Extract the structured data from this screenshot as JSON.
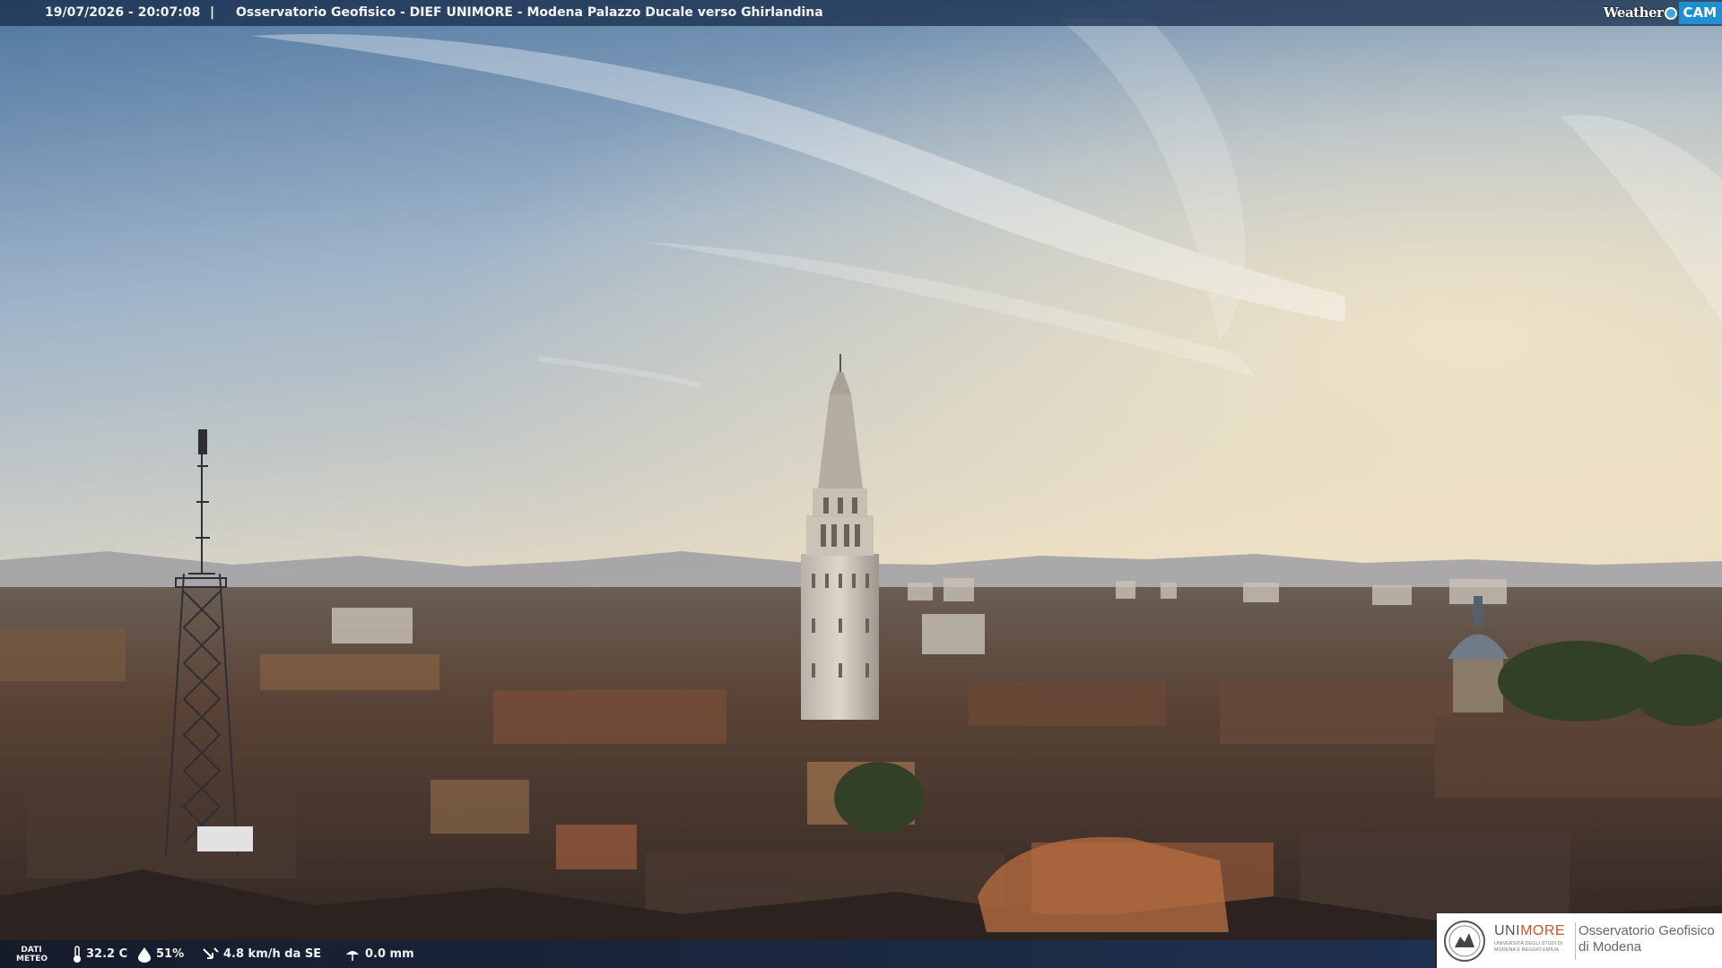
{
  "header": {
    "datetime": "19/07/2026 - 20:07:08",
    "separator": "|",
    "title": "Osservatorio Geofisico - DIEF UNIMORE - Modena Palazzo Ducale verso Ghirlandina",
    "brand_weather": "Weather",
    "brand_cam": "CAM"
  },
  "footer": {
    "dati_label": "DATI",
    "meteo_label": "METEO",
    "temperature": "32.2 C",
    "humidity": "51%",
    "wind": "4.8 km/h da SE",
    "rain": "0.0 mm",
    "icons": [
      "thermometer-icon",
      "humidity-drop-icon",
      "wind-icon",
      "rain-icon"
    ]
  },
  "logo": {
    "uni": "UNI",
    "more": "MORE",
    "uni_sub_line1": "UNIVERSITÀ DEGLI STUDI DI",
    "uni_sub_line2": "MODENA E REGGIO EMILIA",
    "obs_line1": "Osservatorio Geofisico",
    "obs_line2": "di Modena"
  },
  "colors": {
    "sky_top": "#5b7fa6",
    "sky_horizon": "#e9dcc0",
    "roofs": "#5a3d2e",
    "brand_blue": "#1f8fd0",
    "unimore_orange": "#c8562b"
  }
}
